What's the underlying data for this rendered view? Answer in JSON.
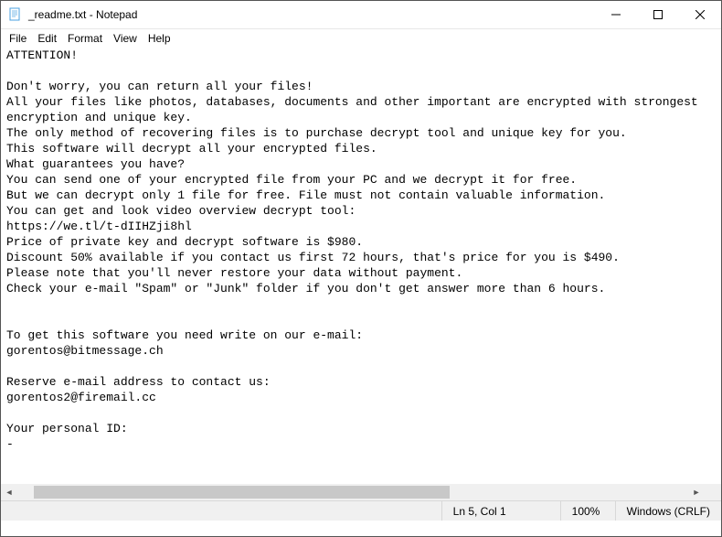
{
  "window": {
    "title": "_readme.txt - Notepad"
  },
  "menu": {
    "file": "File",
    "edit": "Edit",
    "format": "Format",
    "view": "View",
    "help": "Help"
  },
  "content": "ATTENTION!\n\nDon't worry, you can return all your files!\nAll your files like photos, databases, documents and other important are encrypted with strongest encryption and unique key.\nThe only method of recovering files is to purchase decrypt tool and unique key for you.\nThis software will decrypt all your encrypted files.\nWhat guarantees you have?\nYou can send one of your encrypted file from your PC and we decrypt it for free.\nBut we can decrypt only 1 file for free. File must not contain valuable information.\nYou can get and look video overview decrypt tool:\nhttps://we.tl/t-dIIHZji8hl\nPrice of private key and decrypt software is $980.\nDiscount 50% available if you contact us first 72 hours, that's price for you is $490.\nPlease note that you'll never restore your data without payment.\nCheck your e-mail \"Spam\" or \"Junk\" folder if you don't get answer more than 6 hours.\n\n\nTo get this software you need write on our e-mail:\ngorentos@bitmessage.ch\n\nReserve e-mail address to contact us:\ngorentos2@firemail.cc\n\nYour personal ID:\n-",
  "status": {
    "position": "Ln 5, Col 1",
    "zoom": "100%",
    "line_ending": "Windows (CRLF)"
  }
}
